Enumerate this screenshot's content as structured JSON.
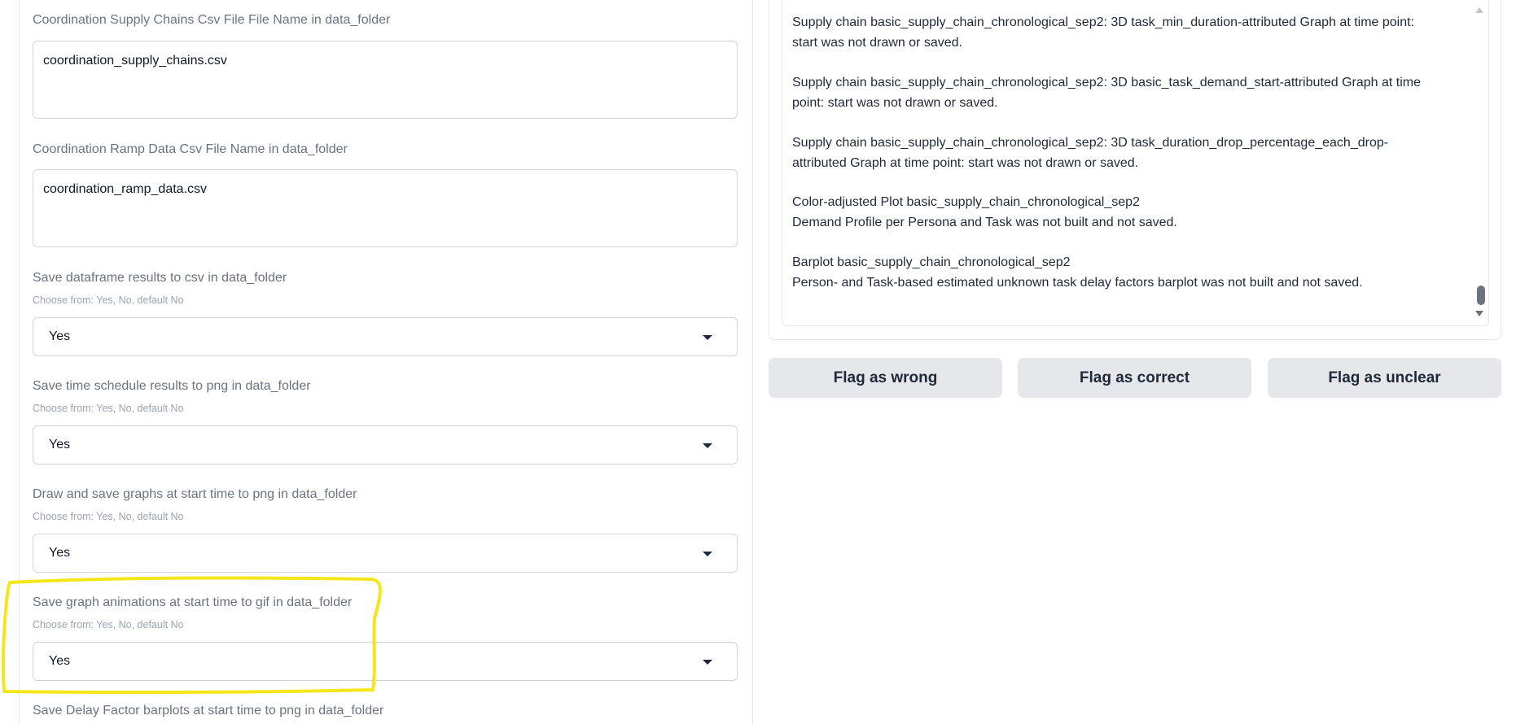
{
  "form": {
    "supply_chains_csv": {
      "label": "Coordination Supply Chains Csv File File Name in data_folder",
      "value": "coordination_supply_chains.csv"
    },
    "ramp_data_csv": {
      "label": "Coordination Ramp Data Csv File Name in data_folder",
      "value": "coordination_ramp_data.csv"
    },
    "save_dataframe": {
      "label": "Save dataframe results to csv in data_folder",
      "info": "Choose from: Yes, No, default No",
      "value": "Yes"
    },
    "save_time_schedule": {
      "label": "Save time schedule results to png in data_folder",
      "info": "Choose from: Yes, No, default No",
      "value": "Yes"
    },
    "draw_graphs": {
      "label": "Draw and save graphs at start time to png in data_folder",
      "info": "Choose from: Yes, No, default No",
      "value": "Yes"
    },
    "save_animations": {
      "label": "Save graph animations at start time to gif in data_folder",
      "info": "Choose from: Yes, No, default No",
      "value": "Yes"
    },
    "save_delay_barplots": {
      "label": "Save Delay Factor barplots at start time to png in data_folder"
    }
  },
  "output_log": [
    " Supply chain basic_supply_chain_chronological_sep2: 3D task_min_duration-attributed Graph at time point:",
    "start was not drawn or saved.",
    " Supply chain basic_supply_chain_chronological_sep2: 3D basic_task_demand_start-attributed Graph at time",
    "point: start was not drawn or saved.",
    " Supply chain basic_supply_chain_chronological_sep2: 3D task_duration_drop_percentage_each_drop-",
    "attributed Graph at time point: start was not drawn or saved.",
    "Color-adjusted Plot basic_supply_chain_chronological_sep2",
    "Demand Profile per Persona and Task was not built and not saved.",
    "Barplot basic_supply_chain_chronological_sep2",
    "Person- and Task-based estimated unknown task delay factors barplot was not built and not saved."
  ],
  "flags": {
    "wrong": "Flag as wrong",
    "correct": "Flag as correct",
    "unclear": "Flag as unclear"
  },
  "colors": {
    "highlight_annotation": "#f5e51b",
    "button_bg": "#e5e7eb"
  }
}
